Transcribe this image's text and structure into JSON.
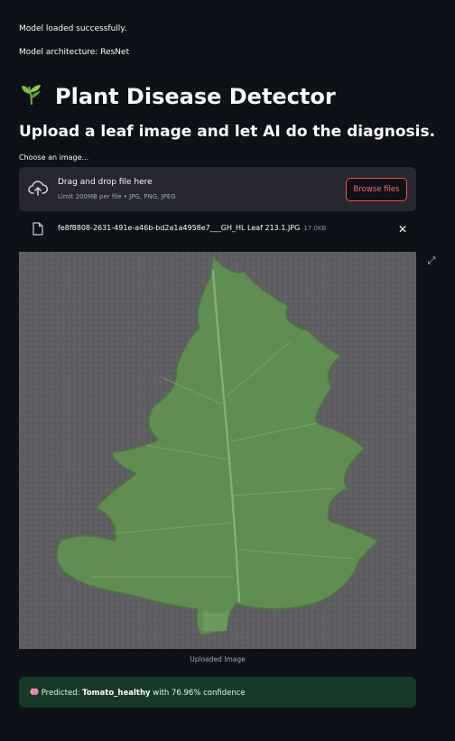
{
  "status": {
    "model_loaded": "Model loaded successfully.",
    "architecture": "Model architecture: ResNet"
  },
  "header": {
    "title": "Plant Disease Detector",
    "icon": "seedling-icon",
    "subtitle": "Upload a leaf image and let AI do the diagnosis."
  },
  "uploader": {
    "label": "Choose an image...",
    "drop_title": "Drag and drop file here",
    "drop_limits": "Limit 200MB per file • JPG, PNG, JPEG",
    "browse_label": "Browse files",
    "file_name": "fe8f8808-2631-491e-a46b-bd2a1a4958e7___GH_HL Leaf 213.1.JPG",
    "file_size": "17.0KB"
  },
  "image": {
    "caption": "Uploaded Image"
  },
  "result": {
    "icon": "brain-icon",
    "prefix": "Predicted: ",
    "label": "Tomato_healthy",
    "suffix": " with 76.96% confidence"
  },
  "colors": {
    "background": "#0e1117",
    "accent": "#ff4b4b",
    "success_bg": "#173928"
  }
}
